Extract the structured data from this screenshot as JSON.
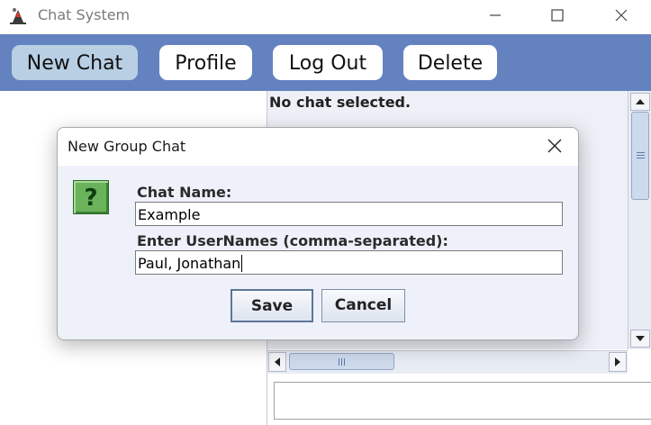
{
  "window": {
    "title": "Chat System",
    "icons": [
      "java-app-icon",
      "minimize-icon",
      "maximize-icon",
      "close-icon"
    ]
  },
  "toolbar": {
    "buttons": [
      {
        "label": "New Chat",
        "state": "hovered"
      },
      {
        "label": "Profile"
      },
      {
        "label": "Log Out"
      },
      {
        "label": "Delete"
      }
    ],
    "background_color": "#6382bf"
  },
  "chat": {
    "status_text": "No chat selected.",
    "message_input": {
      "value": ""
    }
  },
  "dialog": {
    "title": "New Group Chat",
    "icon": "question-icon",
    "fields": [
      {
        "label": "Chat Name:",
        "value": "Example"
      },
      {
        "label": "Enter UserNames (comma-separated):",
        "value": "Paul, Jonathan"
      }
    ],
    "buttons": {
      "save": "Save",
      "cancel": "Cancel"
    },
    "focused_button": "Save"
  }
}
